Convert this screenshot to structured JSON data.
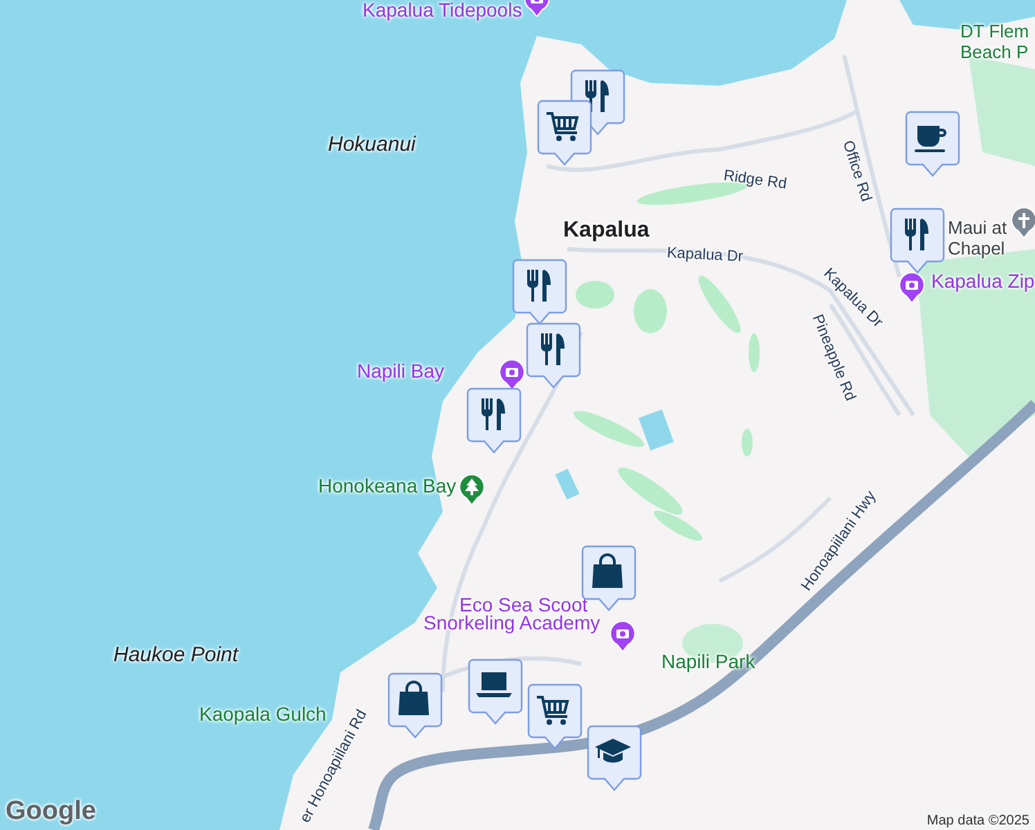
{
  "map": {
    "labels": [
      {
        "text": "Kapalua Tidepools",
        "kind": "poi"
      },
      {
        "text": "DT Flem",
        "kind": "park"
      },
      {
        "text": "Beach P",
        "kind": "park"
      },
      {
        "text": "Hokuanui",
        "kind": "natural"
      },
      {
        "text": "Ridge Rd",
        "kind": "road"
      },
      {
        "text": "Office Rd",
        "kind": "road"
      },
      {
        "text": "Kapalua",
        "kind": "town"
      },
      {
        "text": "Kapalua Dr",
        "kind": "road"
      },
      {
        "text": "Kapalua Dr",
        "kind": "road"
      },
      {
        "text": "Pineapple Rd",
        "kind": "road"
      },
      {
        "text": "Maui at",
        "kind": "place"
      },
      {
        "text": "Chapel",
        "kind": "place"
      },
      {
        "text": "Kapalua Zip",
        "kind": "poi"
      },
      {
        "text": "Napili Bay",
        "kind": "poi"
      },
      {
        "text": "Honokeana Bay",
        "kind": "park"
      },
      {
        "text": "Honoapiilani Hwy",
        "kind": "road"
      },
      {
        "text": "Eco Sea Scoot",
        "kind": "poi"
      },
      {
        "text": "Snorkeling Academy",
        "kind": "poi"
      },
      {
        "text": "Napili Park",
        "kind": "park"
      },
      {
        "text": "Haukoe Point",
        "kind": "natural"
      },
      {
        "text": "Kaopala Gulch",
        "kind": "park"
      },
      {
        "text": "er Honoapiilani Rd",
        "kind": "road"
      }
    ],
    "pins": [
      {
        "kind": "camera"
      },
      {
        "kind": "camera"
      },
      {
        "kind": "camera"
      },
      {
        "kind": "tree"
      },
      {
        "kind": "cross"
      },
      {
        "kind": "camera"
      }
    ],
    "markers": [
      {
        "kind": "restaurant"
      },
      {
        "kind": "cart"
      },
      {
        "kind": "coffee"
      },
      {
        "kind": "restaurant"
      },
      {
        "kind": "restaurant"
      },
      {
        "kind": "restaurant"
      },
      {
        "kind": "restaurant"
      },
      {
        "kind": "bag"
      },
      {
        "kind": "laptop"
      },
      {
        "kind": "cart"
      },
      {
        "kind": "bag"
      },
      {
        "kind": "mortarboard"
      }
    ]
  },
  "logo": "Google",
  "attribution": "Map data ©2025"
}
